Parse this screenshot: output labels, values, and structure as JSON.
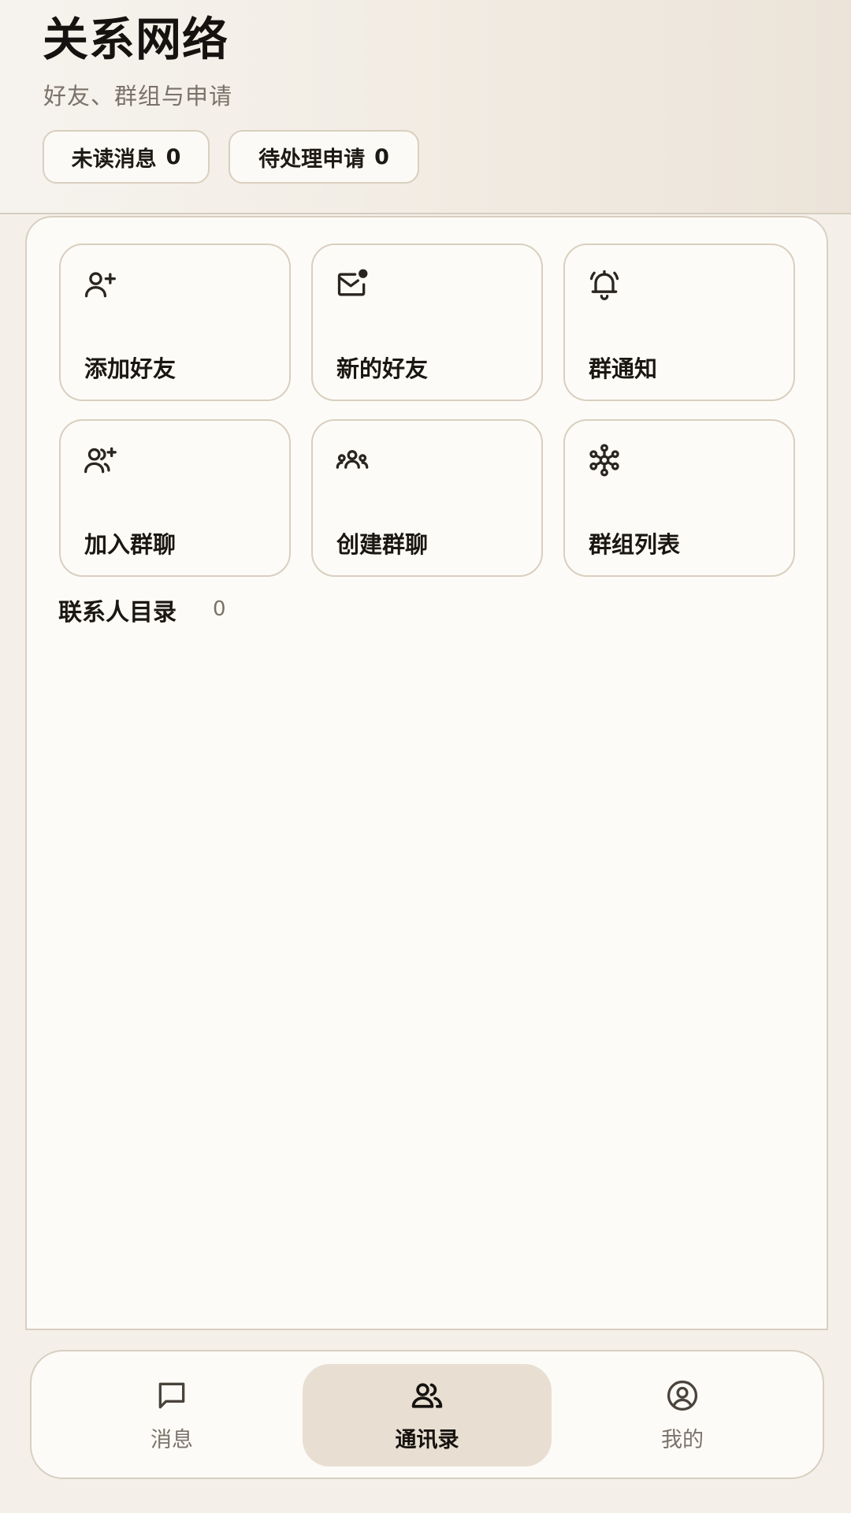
{
  "header": {
    "title": "关系网络",
    "subtitle": "好友、群组与申请",
    "chips": {
      "unread": {
        "label": "未读消息",
        "count": "0"
      },
      "pending": {
        "label": "待处理申请",
        "count": "0"
      }
    }
  },
  "actions": [
    {
      "label": "添加好友",
      "icon": "user-plus-icon"
    },
    {
      "label": "新的好友",
      "icon": "mail-notification-icon"
    },
    {
      "label": "群通知",
      "icon": "bell-ringing-icon"
    },
    {
      "label": "加入群聊",
      "icon": "users-plus-icon"
    },
    {
      "label": "创建群聊",
      "icon": "group-icon"
    },
    {
      "label": "群组列表",
      "icon": "network-nodes-icon"
    }
  ],
  "contacts": {
    "title": "联系人目录",
    "count": "0"
  },
  "nav": {
    "items": [
      {
        "label": "消息",
        "icon": "chat-bubble-icon",
        "active": false
      },
      {
        "label": "通讯录",
        "icon": "contacts-icon",
        "active": true
      },
      {
        "label": "我的",
        "icon": "profile-icon",
        "active": false
      }
    ]
  },
  "colors": {
    "background": "#f4f0e9",
    "panel": "#fdfbf7",
    "border": "#d8cfc1",
    "active_nav": "#e8dfd2",
    "text_primary": "#15120f",
    "text_secondary": "#7a7269"
  }
}
